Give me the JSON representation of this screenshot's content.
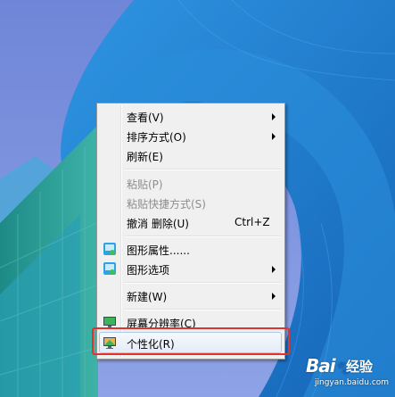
{
  "context_menu": {
    "items": [
      {
        "label": "查看(V)",
        "has_submenu": true,
        "icon": ""
      },
      {
        "label": "排序方式(O)",
        "has_submenu": true,
        "icon": ""
      },
      {
        "label": "刷新(E)",
        "has_submenu": false,
        "icon": ""
      },
      {
        "label": "粘贴(P)",
        "disabled": true,
        "icon": ""
      },
      {
        "label": "粘贴快捷方式(S)",
        "disabled": true,
        "icon": ""
      },
      {
        "label": "撤消 删除(U)",
        "shortcut": "Ctrl+Z",
        "icon": ""
      },
      {
        "label": "图形属性......",
        "icon": "graphics-properties-icon"
      },
      {
        "label": "图形选项",
        "has_submenu": true,
        "icon": "graphics-options-icon"
      },
      {
        "label": "新建(W)",
        "has_submenu": true,
        "icon": ""
      },
      {
        "label": "屏幕分辨率(C)",
        "icon": "screen-resolution-icon"
      },
      {
        "label": "个性化(R)",
        "icon": "personalize-icon",
        "highlighted": true
      }
    ]
  },
  "watermark": {
    "logo": "Bai",
    "logo_paw": "du",
    "brand": "经验",
    "url": "jingyan.baidu.com"
  },
  "colors": {
    "highlight_border": "#e0332b",
    "menu_bg": "#f0f0f0",
    "sky": "#7b8fd6",
    "building": "#1f7fd0"
  }
}
